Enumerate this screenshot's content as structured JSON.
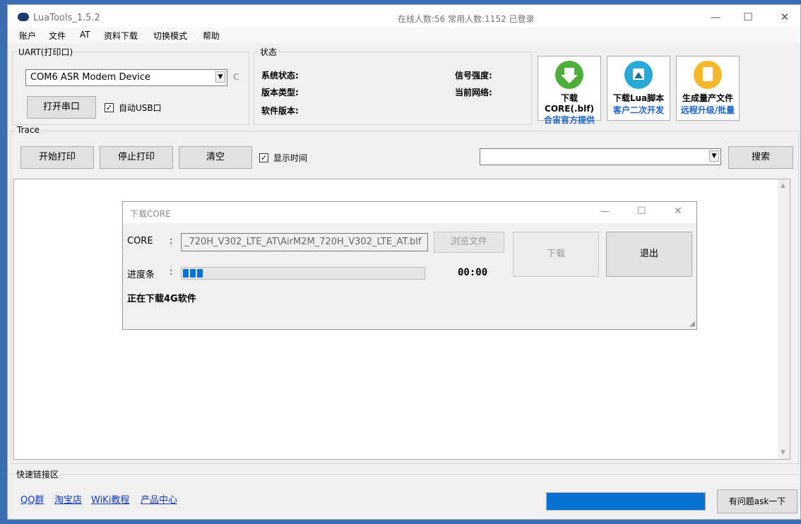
{
  "window": {
    "title": "LuaTools_1.5.2",
    "online_status": "在线人数:56 常用人数:1152 已登录"
  },
  "titlebar_buttons": {
    "minimize": "—",
    "maximize": "☐",
    "close": "✕"
  },
  "menu": [
    "账户",
    "文件",
    "AT",
    "资料下载",
    "切换模式",
    "帮助"
  ],
  "uart": {
    "group_label": "UART(打印口)",
    "port_value": "COM6 ASR Modem Device",
    "refresh_glyph": "C",
    "open_port_label": "打开串口",
    "auto_usb_label": "自动USB口",
    "auto_usb_checked": true
  },
  "status": {
    "group_label": "状态",
    "system_status": "系统状态:",
    "version_type": "版本类型:",
    "software_version": "软件版本:",
    "signal_strength": "信号强度:",
    "current_network": "当前网络:"
  },
  "tools": [
    {
      "line1": "下载CORE(.blf)",
      "line2": "合宙官方提供",
      "icon": "download-arrow-icon",
      "color": "#4caf3a"
    },
    {
      "line1": "下载Lua脚本",
      "line2": "客户二次开发",
      "icon": "script-image-icon",
      "color": "#29a9d8"
    },
    {
      "line1": "生成量产文件",
      "line2": "远程升级/批量",
      "icon": "document-icon",
      "color": "#f4b82a"
    }
  ],
  "trace": {
    "group_label": "Trace",
    "start_print": "开始打印",
    "stop_print": "停止打印",
    "clear": "清空",
    "show_time_label": "显示时间",
    "show_time_checked": true,
    "search_value": "",
    "search_button": "搜索"
  },
  "dialog": {
    "title": "下载CORE",
    "core_label": "CORE",
    "colon": ":",
    "core_path": "_720H_V302_LTE_AT\\AirM2M_720H_V302_LTE_AT.blf",
    "browse_label": "浏览文件",
    "progress_label": "进度条",
    "progress_segments": 3,
    "timer": "00:00",
    "download_label": "下载",
    "exit_label": "退出",
    "status_message": "正在下载4G软件"
  },
  "quick_links": {
    "group_label": "快速链接区",
    "links": [
      "QQ群",
      "淘宝店",
      "WiKi教程",
      "产品中心"
    ],
    "ask_button": "有问题ask一下",
    "status_progress": 1.0
  }
}
